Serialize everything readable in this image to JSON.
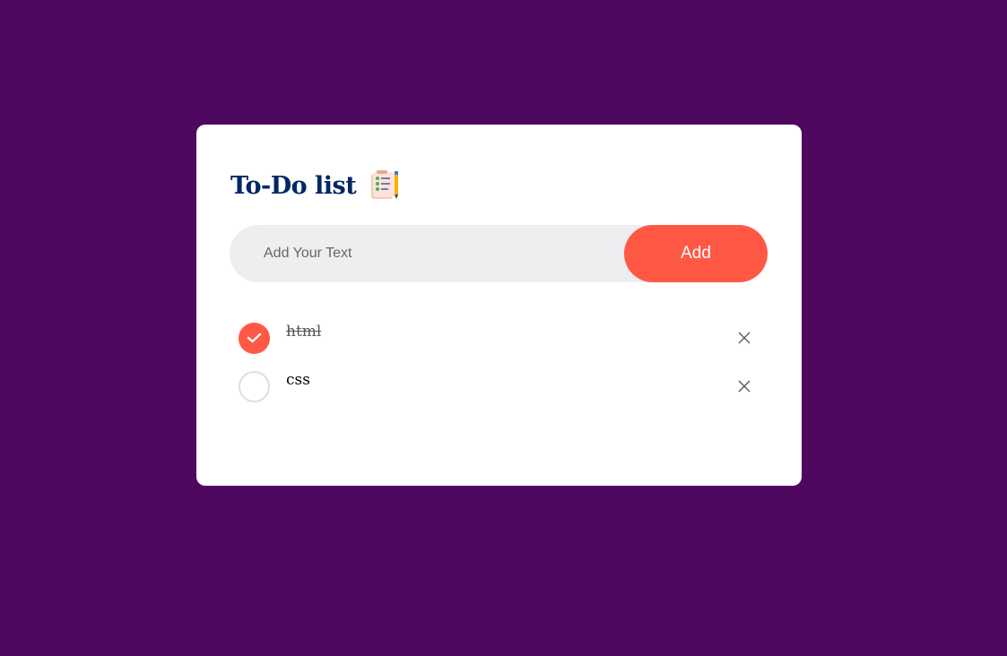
{
  "app": {
    "title": "To-Do list",
    "title_icon": "checklist-notepad-pencil-icon"
  },
  "input": {
    "placeholder": "Add Your Text",
    "value": ""
  },
  "add_button": {
    "label": "Add"
  },
  "tasks": [
    {
      "text": "html",
      "completed": true
    },
    {
      "text": "css",
      "completed": false
    }
  ],
  "colors": {
    "background": "#4e085f",
    "accent": "#ff5945",
    "title": "#002765",
    "input_bg": "#edeef0"
  }
}
